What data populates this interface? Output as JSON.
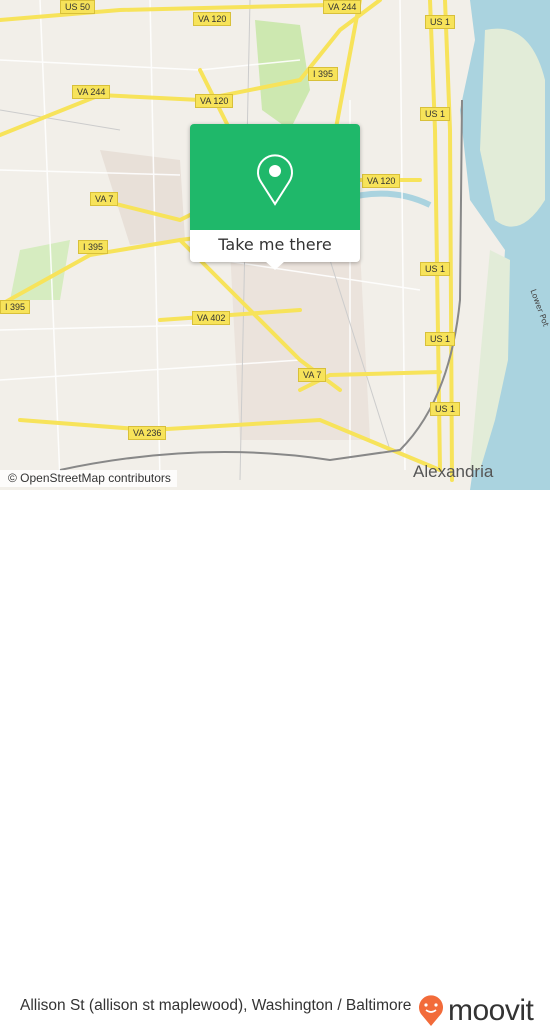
{
  "map": {
    "shields": [
      {
        "label": "US 50"
      },
      {
        "label": "VA 120"
      },
      {
        "label": "VA 244"
      },
      {
        "label": "US 1"
      },
      {
        "label": "VA 244"
      },
      {
        "label": "VA 120"
      },
      {
        "label": "I 395"
      },
      {
        "label": "US 1"
      },
      {
        "label": "VA 120"
      },
      {
        "label": "VA 7"
      },
      {
        "label": "I 395"
      },
      {
        "label": "US 1"
      },
      {
        "label": "I 395"
      },
      {
        "label": "US 1"
      },
      {
        "label": "VA 402"
      },
      {
        "label": "VA 7"
      },
      {
        "label": "US 1"
      },
      {
        "label": "VA 236"
      }
    ],
    "city_label": "Alexandria",
    "river_label": "Lower Pot",
    "attribution": "© OpenStreetMap contributors",
    "colors": {
      "land": "#f2efe9",
      "water": "#aad3df",
      "road": "#f7e35a",
      "park": "#cde8b0",
      "popup": "#1fb86a",
      "brand": "#f26b3a"
    }
  },
  "popup": {
    "icon": "map-pin-icon",
    "button_label": "Take me there"
  },
  "footer": {
    "place_name": "Allison St (allison st maplewood), Washington / Baltimore",
    "brand": "moovit",
    "brand_icon": "moovit-pin-icon"
  }
}
